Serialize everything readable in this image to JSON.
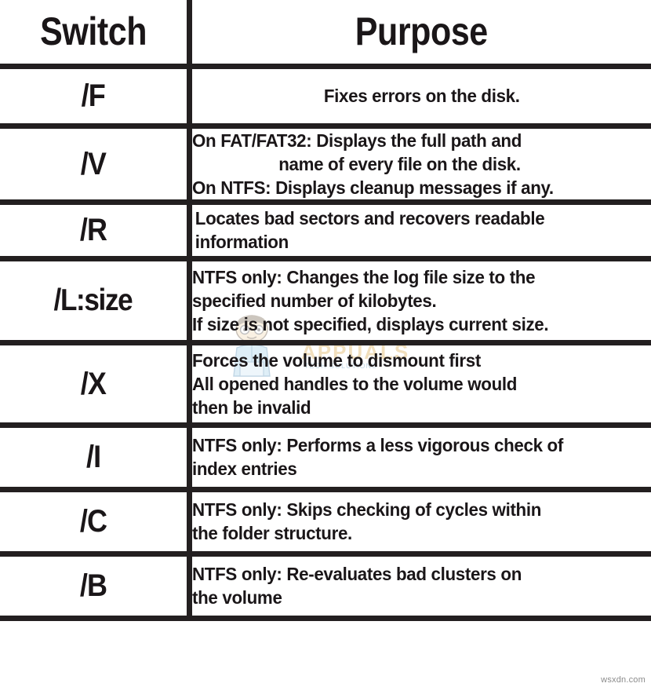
{
  "table": {
    "headers": {
      "switch": "Switch",
      "purpose": "Purpose"
    },
    "rows": [
      {
        "switch": "/F",
        "align": "center",
        "lines": [
          "Fixes errors on the disk."
        ]
      },
      {
        "switch": "/V",
        "align": "left",
        "lines": [
          "On FAT/FAT32: Displays the full path and",
          "name of every file on the disk.",
          "On NTFS: Displays cleanup messages if any."
        ],
        "indented_lines": [
          1
        ]
      },
      {
        "switch": "/R",
        "align": "left",
        "lines": [
          "Locates bad sectors and recovers readable",
          "information"
        ]
      },
      {
        "switch": "/L:size",
        "align": "left",
        "lines": [
          "NTFS only:  Changes the log file size to the",
          "specified number of kilobytes.",
          "If size is not specified, displays current size."
        ]
      },
      {
        "switch": "/X",
        "align": "left",
        "lines": [
          "Forces the volume to dismount first",
          "All opened handles to the volume would",
          "then be invalid"
        ]
      },
      {
        "switch": "/I",
        "align": "left",
        "lines": [
          "NTFS only: Performs a less vigorous check of",
          "index entries"
        ]
      },
      {
        "switch": "/C",
        "align": "left",
        "lines": [
          "NTFS only: Skips checking of cycles within",
          "the folder structure."
        ]
      },
      {
        "switch": "/B",
        "align": "left",
        "lines": [
          "NTFS only: Re-evaluates bad clusters on",
          "the volume"
        ]
      }
    ]
  },
  "watermarks": {
    "center": {
      "text": "APPUALS",
      "subtext": "TECH SOLUTIONS",
      "color": "#d9a441"
    },
    "corner": {
      "text": "wsxdn.com",
      "color": "#8b8b8b"
    }
  },
  "colors": {
    "border": "#231f20",
    "text": "#1a1618",
    "background": "#ffffff"
  }
}
